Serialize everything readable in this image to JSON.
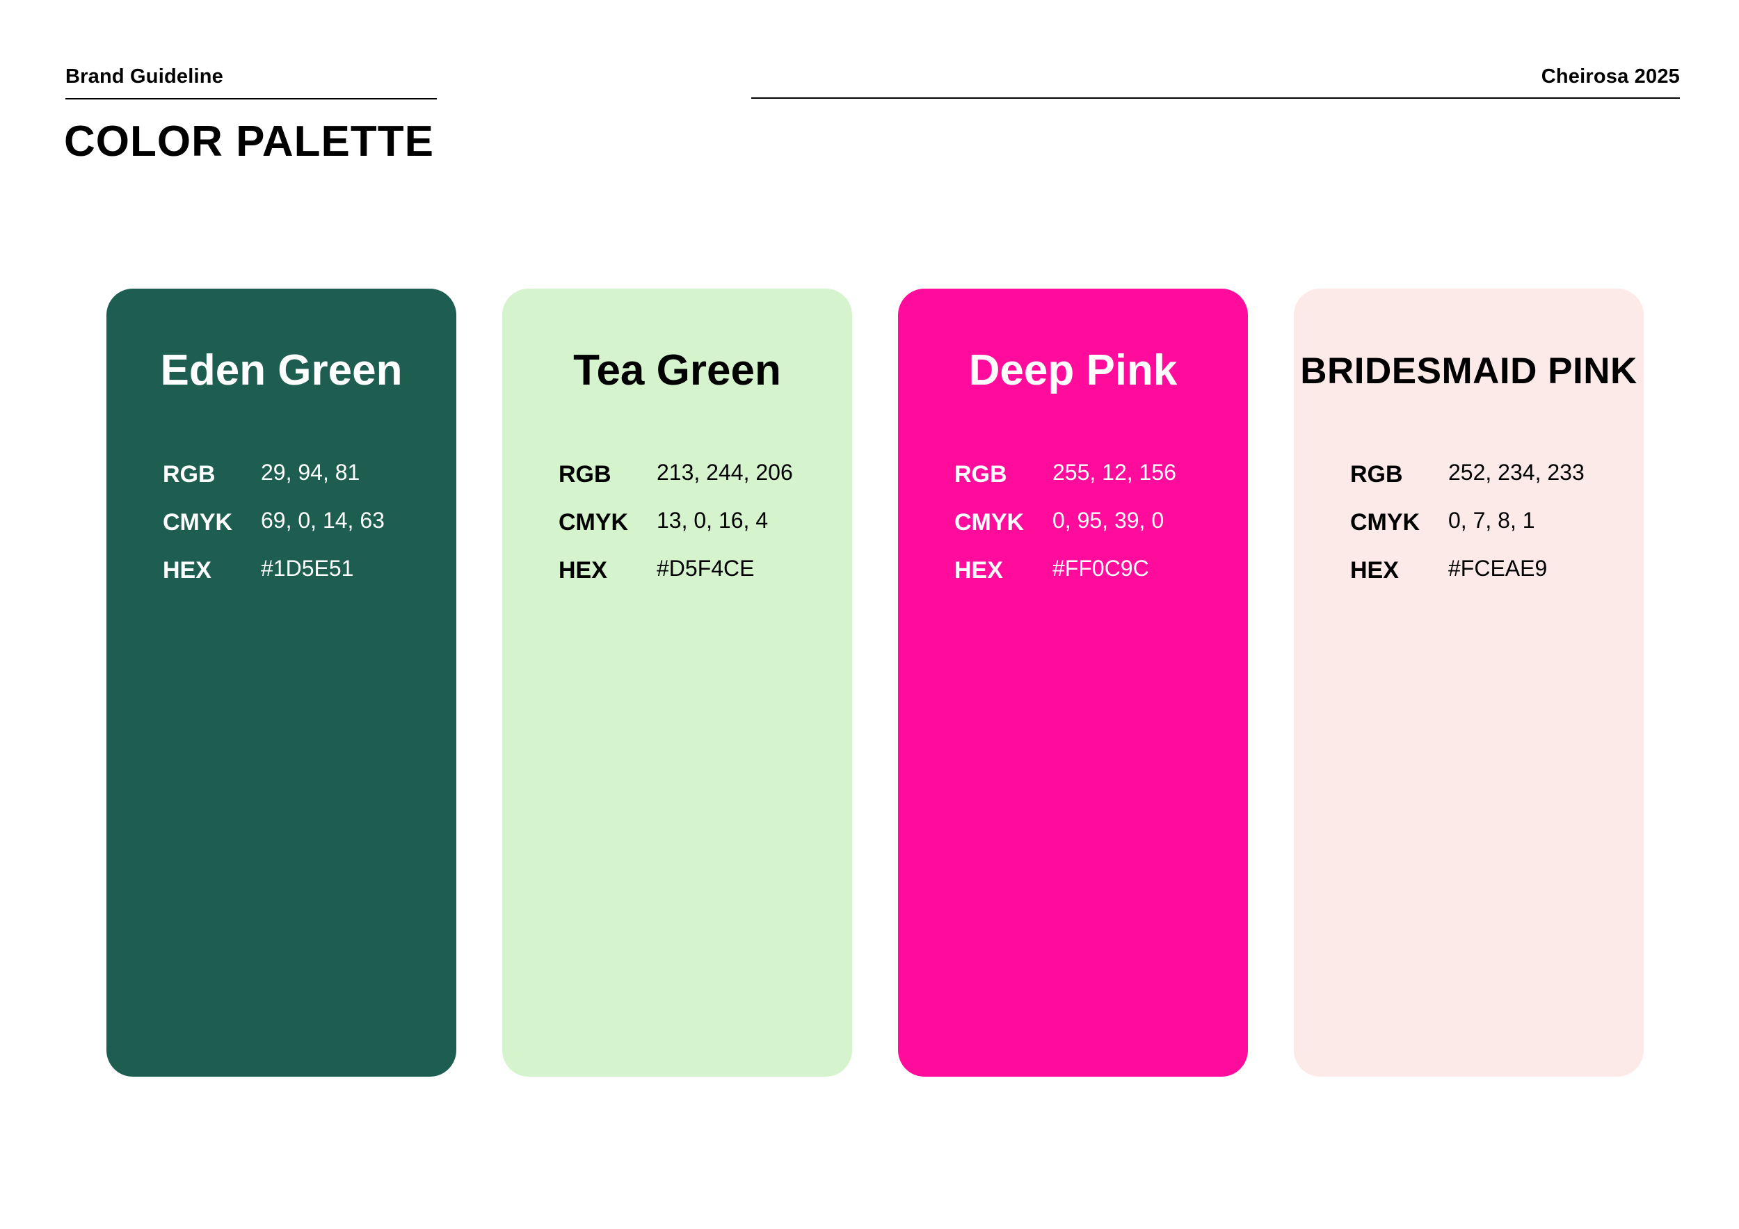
{
  "header": {
    "left_label": "Brand Guideline",
    "right_label": "Cheirosa 2025",
    "title": "COLOR PALETTE"
  },
  "swatches": [
    {
      "name": "Eden Green",
      "color": "#1D5E51",
      "text_color": "#FFFFFF",
      "rgb_label": "RGB",
      "rgb": "29, 94, 81",
      "cmyk_label": "CMYK",
      "cmyk": "69, 0, 14, 63",
      "hex_label": "HEX",
      "hex": "#1D5E51"
    },
    {
      "name": "Tea Green",
      "color": "#D5F4CE",
      "text_color": "#000000",
      "rgb_label": "RGB",
      "rgb": "213, 244, 206",
      "cmyk_label": "CMYK",
      "cmyk": "13, 0, 16, 4",
      "hex_label": "HEX",
      "hex": "#D5F4CE"
    },
    {
      "name": "Deep Pink",
      "color": "#FF0C9C",
      "text_color": "#FFFFFF",
      "rgb_label": "RGB",
      "rgb": "255, 12, 156",
      "cmyk_label": "CMYK",
      "cmyk": "0, 95, 39, 0",
      "hex_label": "HEX",
      "hex": "#FF0C9C"
    },
    {
      "name": "BRIDESMAID PINK",
      "color": "#FCEAE9",
      "text_color": "#000000",
      "rgb_label": "RGB",
      "rgb": "252, 234, 233",
      "cmyk_label": "CMYK",
      "cmyk": "0, 7, 8, 1",
      "hex_label": "HEX",
      "hex": "#FCEAE9"
    }
  ]
}
